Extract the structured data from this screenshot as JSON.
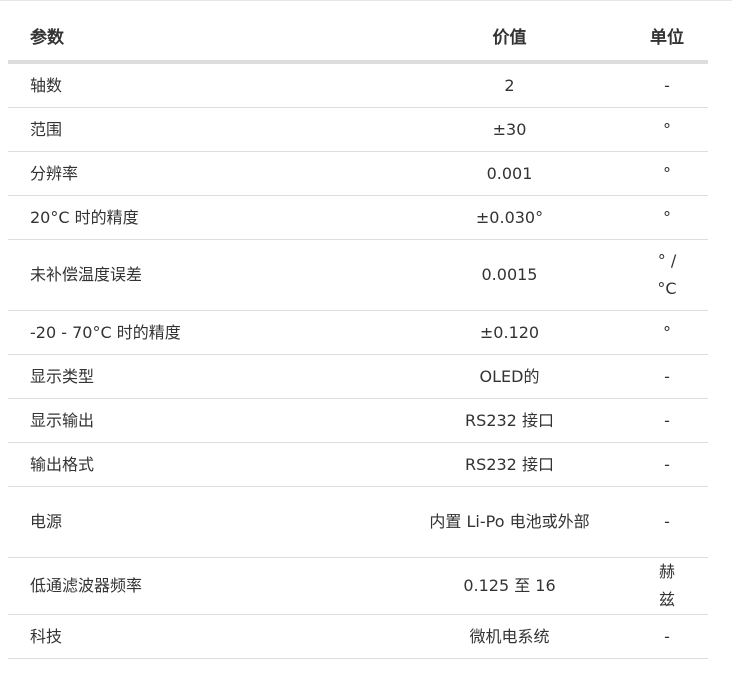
{
  "table": {
    "headers": {
      "name": "参数",
      "value": "价值",
      "unit": "单位"
    },
    "rows": [
      {
        "name": "轴数",
        "value": "2",
        "unit": "-"
      },
      {
        "name": "范围",
        "value": "±30",
        "unit": "°"
      },
      {
        "name": "分辨率",
        "value": "0.001",
        "unit": "°"
      },
      {
        "name": "20°C 时的精度",
        "value": "±0.030°",
        "unit": "°"
      },
      {
        "name": "未补偿温度误差",
        "value": "0.0015",
        "unit": "° / °C"
      },
      {
        "name": "-20 - 70°C 时的精度",
        "value": "±0.120",
        "unit": "°"
      },
      {
        "name": "显示类型",
        "value": "OLED的",
        "unit": "-"
      },
      {
        "name": "显示输出",
        "value": "RS232 接口",
        "unit": "-"
      },
      {
        "name": "输出格式",
        "value": "RS232 接口",
        "unit": "-"
      },
      {
        "name": "电源",
        "value": "内置 Li-Po 电池或外部",
        "unit": "-"
      },
      {
        "name": "低通滤波器频率",
        "value": "0.125 至 16",
        "unit": "赫兹"
      },
      {
        "name": "科技",
        "value": "微机电系统",
        "unit": "-"
      }
    ]
  }
}
